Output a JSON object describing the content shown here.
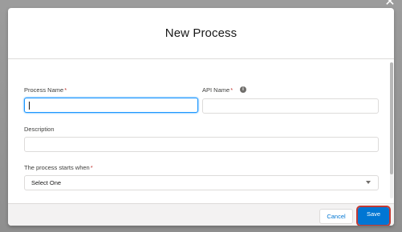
{
  "modal": {
    "title": "New Process",
    "close_icon": "close-icon"
  },
  "form": {
    "process_name": {
      "label": "Process Name",
      "required_mark": "*",
      "value": ""
    },
    "api_name": {
      "label": "API Name",
      "required_mark": "*",
      "value": "",
      "info_icon": "info-icon"
    },
    "description": {
      "label": "Description",
      "value": ""
    },
    "process_starts_when": {
      "label": "The process starts when",
      "required_mark": "*",
      "selected": "Select One"
    }
  },
  "footer": {
    "cancel_label": "Cancel",
    "save_label": "Save"
  },
  "colors": {
    "primary": "#0176d3",
    "focus": "#1b96ff",
    "required": "#c23934",
    "highlight_outline": "#c23934"
  }
}
